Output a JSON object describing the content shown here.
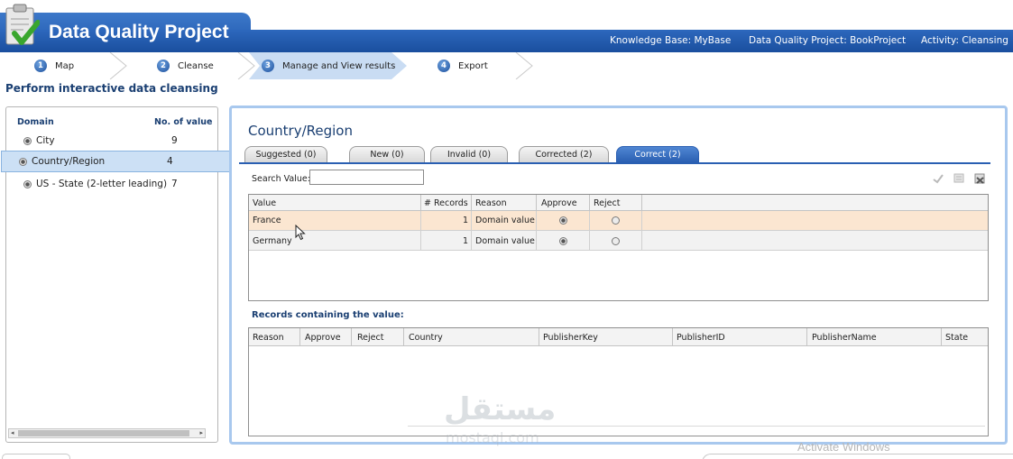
{
  "header": {
    "app_title": "Data Quality Project",
    "knowledge_base": "Knowledge Base: MyBase",
    "project": "Data Quality Project: BookProject",
    "activity": "Activity: Cleansing"
  },
  "steps": [
    {
      "num": "1",
      "label": "Map",
      "active": false
    },
    {
      "num": "2",
      "label": "Cleanse",
      "active": false
    },
    {
      "num": "3",
      "label": "Manage and View results",
      "active": true
    },
    {
      "num": "4",
      "label": "Export",
      "active": false
    }
  ],
  "page_title": "Perform interactive data cleansing",
  "domains_panel": {
    "col_domain": "Domain",
    "col_count": "No. of value",
    "rows": [
      {
        "name": "City",
        "count": "9",
        "selected": false
      },
      {
        "name": "Country/Region",
        "count": "4",
        "selected": true
      },
      {
        "name": "US - State (2-letter leading)",
        "count": "7",
        "selected": false
      }
    ]
  },
  "results_panel": {
    "title": "Country/Region",
    "tabs": [
      {
        "label": "Suggested (0)",
        "active": false
      },
      {
        "label": "New (0)",
        "active": false
      },
      {
        "label": "Invalid (0)",
        "active": false
      },
      {
        "label": "Corrected (2)",
        "active": false
      },
      {
        "label": "Correct (2)",
        "active": true
      }
    ],
    "search_label": "Search Value:",
    "search_value": "",
    "toolbar_icons": [
      "approve-all-icon",
      "reject-all-icon",
      "delete-icon"
    ],
    "values_grid": {
      "columns": [
        "Value",
        "# Records",
        "Reason",
        "Approve",
        "Reject"
      ],
      "rows": [
        {
          "value": "France",
          "records": "1",
          "reason": "Domain value",
          "approve": true,
          "reject": false
        },
        {
          "value": "Germany",
          "records": "1",
          "reason": "Domain value",
          "approve": true,
          "reject": false
        }
      ]
    },
    "records_title": "Records containing the value:",
    "records_grid": {
      "columns": [
        "Reason",
        "Approve",
        "Reject",
        "Country",
        "PublisherKey",
        "PublisherID",
        "PublisherName",
        "State"
      ]
    }
  },
  "watermark": {
    "arabic": "مستقل",
    "latin": "mostaql.com"
  },
  "os_overlay": "Activate Windows"
}
